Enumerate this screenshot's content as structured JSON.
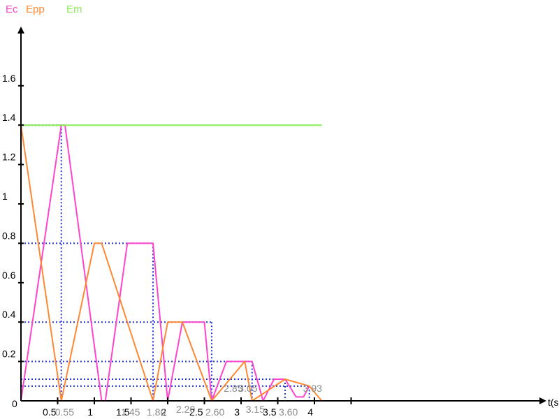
{
  "chart_data": {
    "type": "line",
    "title": "",
    "xlabel": "t(s",
    "ylabel": "",
    "xlim": [
      0,
      6.2
    ],
    "ylim": [
      0,
      1.8
    ],
    "grid": false,
    "legend_position": "top-left",
    "x_ticks": [
      {
        "v": 0,
        "label": "0"
      },
      {
        "v": 0.5,
        "label": "0.5"
      },
      {
        "v": 1,
        "label": "1"
      },
      {
        "v": 1.5,
        "label": "1.5"
      },
      {
        "v": 2,
        "label": "2"
      },
      {
        "v": 2.5,
        "label": "2.5"
      },
      {
        "v": 3,
        "label": "3"
      },
      {
        "v": 3.5,
        "label": "3.5"
      },
      {
        "v": 4,
        "label": "4"
      },
      {
        "v": 4.5,
        "label": ""
      }
    ],
    "y_ticks": [
      {
        "v": 0.2,
        "label": "0.2"
      },
      {
        "v": 0.4,
        "label": "0.4"
      },
      {
        "v": 0.6,
        "label": "0.6"
      },
      {
        "v": 0.8,
        "label": "0.8"
      },
      {
        "v": 1.0,
        "label": "1"
      },
      {
        "v": 1.2,
        "label": "1.2"
      },
      {
        "v": 1.4,
        "label": "1.4"
      },
      {
        "v": 1.6,
        "label": "1.6"
      }
    ],
    "origin_label": "0",
    "x_annotations": [
      {
        "v": 0.55,
        "label": "0.55"
      },
      {
        "v": 1.45,
        "label": "1.45"
      },
      {
        "v": 1.8,
        "label": "1.80"
      },
      {
        "v": 2.2,
        "label": "2.20"
      },
      {
        "v": 2.6,
        "label": "2.60"
      },
      {
        "v": 2.85,
        "label": "2.85"
      },
      {
        "v": 3.05,
        "label": "3.05"
      },
      {
        "v": 3.15,
        "label": "3.15"
      },
      {
        "v": 3.6,
        "label": "3.60"
      },
      {
        "v": 3.93,
        "label": "3.93"
      }
    ],
    "guide_lines": [
      {
        "x": 0.55,
        "y": 1.4
      },
      {
        "x": 1.8,
        "y": 0.8
      },
      {
        "x": 2.6,
        "y": 0.4
      },
      {
        "x": 3.15,
        "y": 0.2
      },
      {
        "x": 3.6,
        "y": 0.11
      },
      {
        "x": 3.93,
        "y": 0.075
      }
    ],
    "series": [
      {
        "name": "Ec",
        "color": "#ff44cc",
        "x": [
          0,
          0.55,
          0.6,
          1.1,
          1.15,
          1.45,
          1.7,
          1.8,
          2.0,
          2.2,
          2.35,
          2.5,
          2.6,
          2.8,
          3.0,
          3.15,
          3.3,
          3.45,
          3.6,
          3.75,
          3.85,
          3.93
        ],
        "values": [
          0,
          1.4,
          1.4,
          0,
          0,
          0.8,
          0.8,
          0.8,
          0,
          0.4,
          0.4,
          0.4,
          0,
          0.2,
          0.2,
          0.2,
          0,
          0.11,
          0.11,
          0.02,
          0.02,
          0.075
        ]
      },
      {
        "name": "Epp",
        "color": "#ff8833",
        "x": [
          0,
          0.55,
          1.0,
          1.1,
          1.8,
          2.0,
          2.2,
          2.6,
          3.05,
          3.15,
          3.6,
          3.93,
          4.1
        ],
        "values": [
          1.4,
          0,
          0.8,
          0.8,
          0,
          0.4,
          0.4,
          0,
          0.2,
          0,
          0.11,
          0.075,
          0
        ]
      },
      {
        "name": "Em",
        "color": "#88ee55",
        "x": [
          0,
          4.1
        ],
        "values": [
          1.4,
          1.4
        ]
      }
    ]
  }
}
